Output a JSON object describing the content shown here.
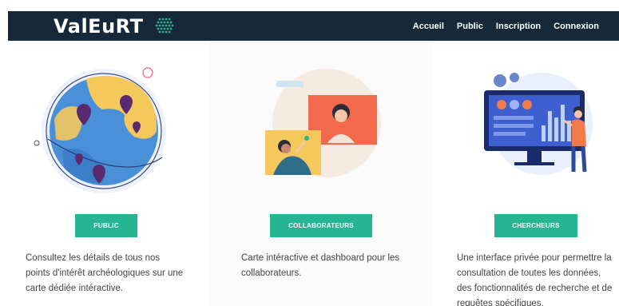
{
  "header": {
    "brand": "ValEuRT",
    "nav": [
      "Accueil",
      "Public",
      "Inscription",
      "Connexion"
    ]
  },
  "cards": [
    {
      "button": "PUBLIC",
      "description": "Consultez les détails de tous nos points d'intérêt archéologiques sur une carte dédiée intéractive."
    },
    {
      "button": "COLLABORATEURS",
      "description": "Carte intéractive et dashboard pour les collaborateurs."
    },
    {
      "button": "CHERCHEURS",
      "description": "Une interface privée pour permettre la consultation de toutes les données, des fonctionnalités de recherche et de requêtes spécifiques."
    }
  ],
  "colors": {
    "navbar": "#16293a",
    "accent": "#26b593",
    "map_blue": "#4a90d9",
    "map_yellow": "#f5c85c",
    "pin_purple": "#5b2a6e",
    "orange": "#f07a4a"
  },
  "icons": [
    "logo-dots-icon",
    "globe-map-illustration",
    "video-call-illustration",
    "dashboard-screen-illustration"
  ]
}
